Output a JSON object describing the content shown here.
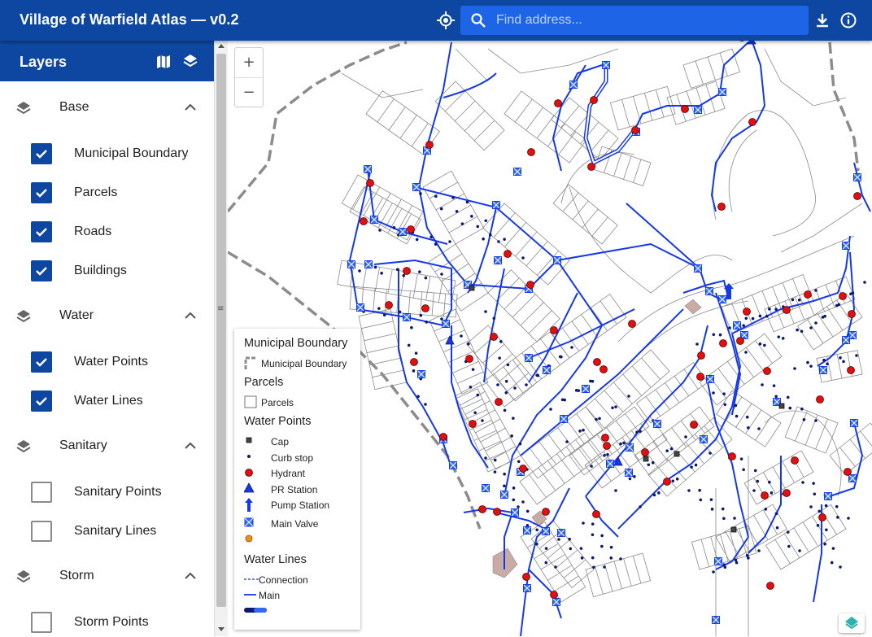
{
  "app": {
    "title": "Village of Warfield Atlas — v0.2"
  },
  "search": {
    "placeholder": "Find address..."
  },
  "icons": {
    "locate": "my-location-icon",
    "search": "search-icon",
    "download": "download-icon",
    "info": "info-icon",
    "map": "map-icon",
    "layers": "layers-icon",
    "collapse": "chevron-up-icon"
  },
  "colors": {
    "appbar": "#0d47a1",
    "search_bg": "#1e64e6",
    "water_main": "#1538e8",
    "hydrant": "#e01010",
    "checkbox": "#0d47a1",
    "boundary": "#8c8c8c",
    "parcels": "#8a8a8a"
  },
  "sidebar": {
    "title": "Layers",
    "groups": [
      {
        "label": "Base",
        "items": [
          {
            "label": "Municipal Boundary",
            "checked": true
          },
          {
            "label": "Parcels",
            "checked": true
          },
          {
            "label": "Roads",
            "checked": true
          },
          {
            "label": "Buildings",
            "checked": true
          }
        ]
      },
      {
        "label": "Water",
        "items": [
          {
            "label": "Water Points",
            "checked": true
          },
          {
            "label": "Water Lines",
            "checked": true
          }
        ]
      },
      {
        "label": "Sanitary",
        "items": [
          {
            "label": "Sanitary Points",
            "checked": false
          },
          {
            "label": "Sanitary Lines",
            "checked": false
          }
        ]
      },
      {
        "label": "Storm",
        "items": [
          {
            "label": "Storm Points",
            "checked": false
          }
        ]
      }
    ]
  },
  "map": {
    "zoom_in": "+",
    "zoom_out": "−"
  },
  "legend": {
    "sections": [
      {
        "title": "Municipal Boundary",
        "items": [
          {
            "label": "Municipal Boundary",
            "symbol": "boundary"
          }
        ]
      },
      {
        "title": "Parcels",
        "items": [
          {
            "label": "Parcels",
            "symbol": "parcel"
          }
        ]
      },
      {
        "title": "Water Points",
        "items": [
          {
            "label": "Cap",
            "symbol": "cap"
          },
          {
            "label": "Curb stop",
            "symbol": "curb"
          },
          {
            "label": "Hydrant",
            "symbol": "hydrant"
          },
          {
            "label": "PR Station",
            "symbol": "pr"
          },
          {
            "label": "Pump Station",
            "symbol": "pump"
          },
          {
            "label": "Main Valve",
            "symbol": "valve"
          },
          {
            "label": "",
            "symbol": "orange"
          }
        ]
      },
      {
        "title": "Water Lines",
        "items": [
          {
            "label": "Connection",
            "symbol": "connection"
          },
          {
            "label": "Main",
            "symbol": "main"
          },
          {
            "label": "",
            "symbol": "pill"
          }
        ]
      }
    ]
  }
}
